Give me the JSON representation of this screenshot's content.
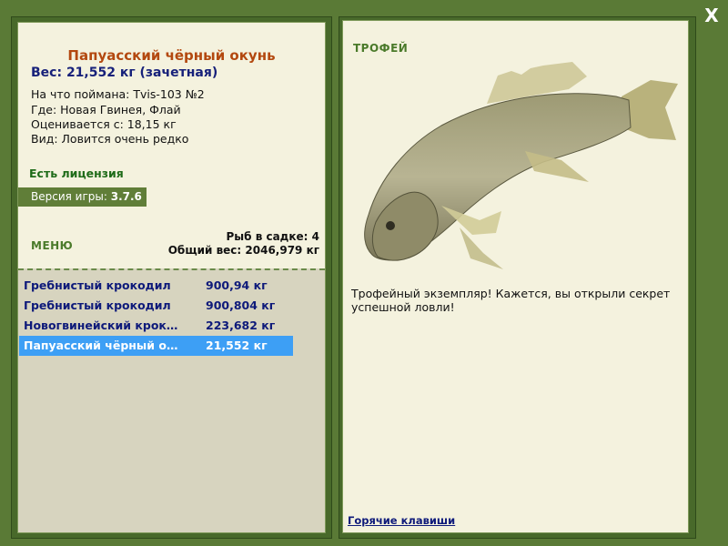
{
  "fish": {
    "name": "Папуасский чёрный окунь",
    "weight": "Вес: 21,552 кг (зачетная)",
    "bait": "На что поймана: Tvis-103 №2",
    "location": "Где: Новая Гвинея, Флай",
    "value": "Оценивается с: 18,15 кг",
    "rarity": "Вид: Ловится очень редко"
  },
  "license": "Есть лицензия",
  "version": {
    "label": "Версия игры:",
    "value": "3.7.6"
  },
  "menu_label": "МЕНЮ",
  "cage": {
    "count": "Рыб в садке: 4",
    "total": "Общий вес: 2046,979 кг"
  },
  "catch_list": [
    {
      "name": "Гребнистый крокодил",
      "weight": "900,94 кг"
    },
    {
      "name": "Гребнистый крокодил",
      "weight": "900,804 кг"
    },
    {
      "name": "Новогвинейский крокодил",
      "weight": "223,682 кг"
    },
    {
      "name": "Папуасский чёрный окунь",
      "weight": "21,552 кг"
    }
  ],
  "selected_index": 3,
  "trophy": {
    "label": "ТРОФЕЙ",
    "text": "Трофейный экземпляр! Кажется, вы открыли секрет успешной ловли!"
  },
  "hotkeys_link": "Горячие клавиши",
  "close_label": "X",
  "colors": {
    "bg": "#5a7a36",
    "panel": "#f4f2de",
    "list_bg": "#d7d4bf",
    "selected": "#3d9ff5",
    "title": "#b3480f",
    "weight": "#17217a"
  }
}
